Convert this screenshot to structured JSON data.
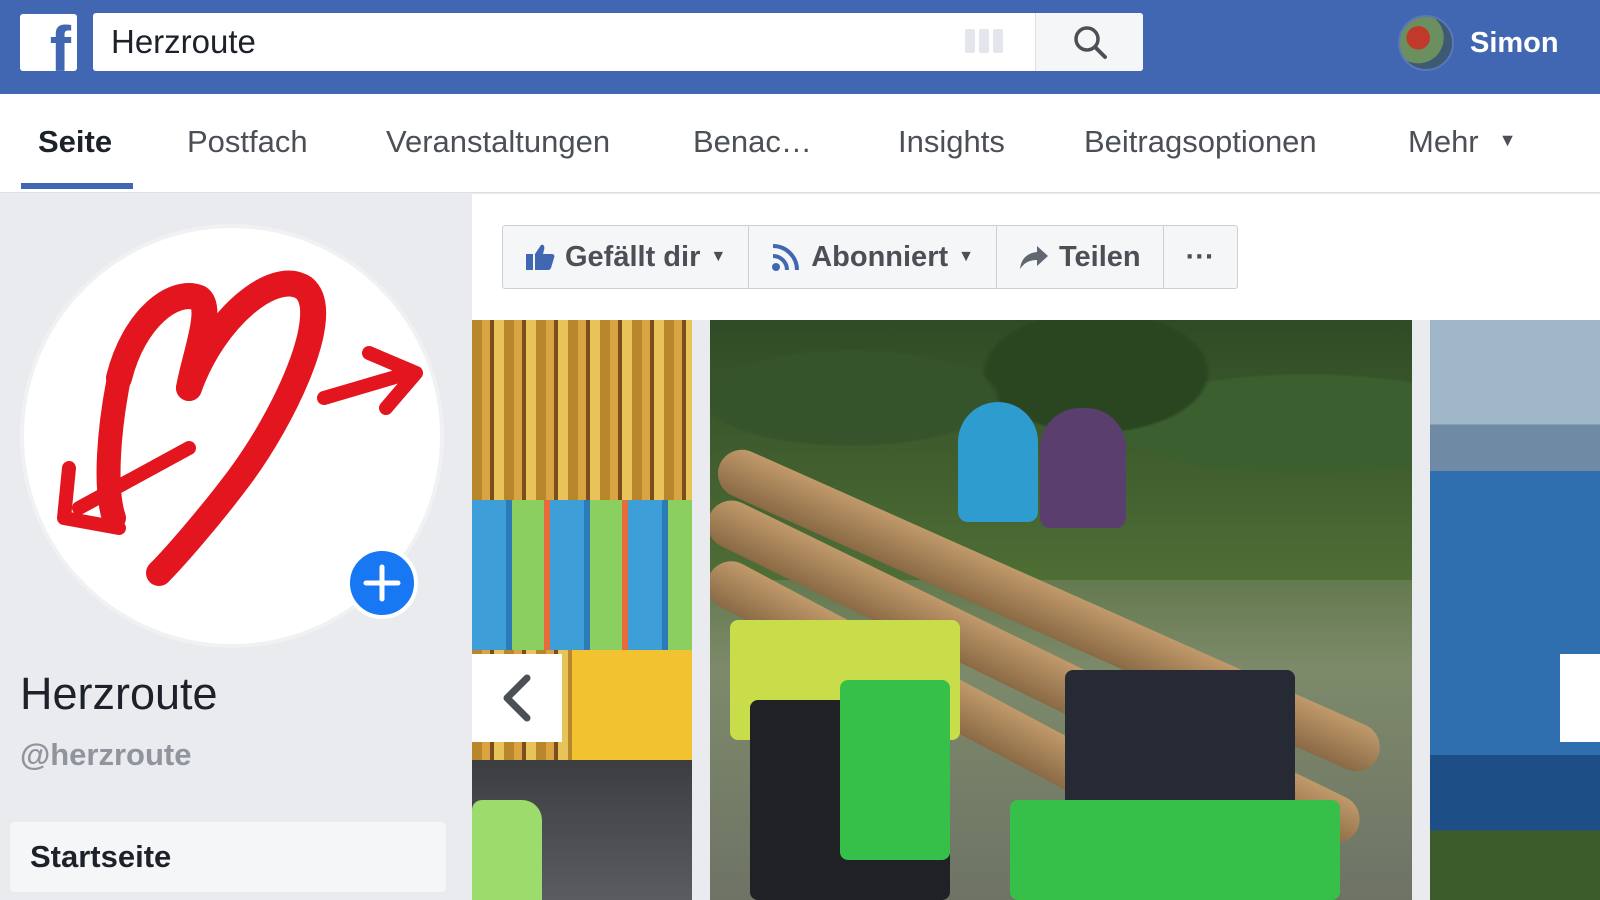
{
  "topbar": {
    "logo_letter": "f",
    "search": {
      "value": "Herzroute"
    },
    "user": {
      "name": "Simon"
    }
  },
  "tabs": [
    {
      "label": "Seite",
      "active": true
    },
    {
      "label": "Postfach"
    },
    {
      "label": "Veranstaltungen"
    },
    {
      "label": "Benac…"
    },
    {
      "label": "Insights"
    },
    {
      "label": "Beitragsoptionen"
    },
    {
      "label": "Mehr"
    }
  ],
  "page": {
    "name": "Herzroute",
    "handle": "@herzroute",
    "nav_home": "Startseite"
  },
  "actions": {
    "like": "Gefällt dir",
    "follow": "Abonniert",
    "share": "Teilen",
    "more": "···"
  },
  "colors": {
    "brand_blue": "#4267b2",
    "logo_red": "#e3161f",
    "add_button": "#1877f2"
  }
}
